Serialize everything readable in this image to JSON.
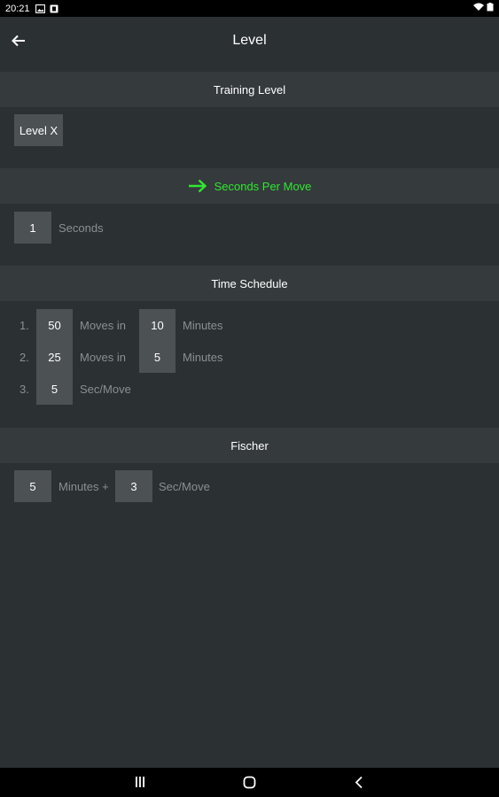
{
  "status_bar": {
    "time": "20:21",
    "icons": [
      "image-icon",
      "notification-icon",
      "wifi-icon",
      "battery-icon"
    ]
  },
  "app_bar": {
    "title": "Level",
    "back_icon": "arrow-left-icon"
  },
  "training_level": {
    "header": "Training Level",
    "button_label": "Level X"
  },
  "seconds_per_move": {
    "header": "Seconds Per Move",
    "selected": true,
    "value": "1",
    "unit": "Seconds",
    "accent_color": "#2ee82e"
  },
  "time_schedule": {
    "header": "Time Schedule",
    "rows": [
      {
        "index": "1.",
        "moves": "50",
        "moves_label": "Moves in",
        "minutes": "10",
        "minutes_label": "Minutes"
      },
      {
        "index": "2.",
        "moves": "25",
        "moves_label": "Moves in",
        "minutes": "5",
        "minutes_label": "Minutes"
      },
      {
        "index": "3.",
        "seconds": "5",
        "seconds_label": "Sec/Move"
      }
    ]
  },
  "fischer": {
    "header": "Fischer",
    "minutes": "5",
    "minutes_label": "Minutes +",
    "increment": "3",
    "increment_label": "Sec/Move"
  },
  "nav_bar": {
    "icons": [
      "recents-icon",
      "home-icon",
      "back-icon"
    ]
  }
}
